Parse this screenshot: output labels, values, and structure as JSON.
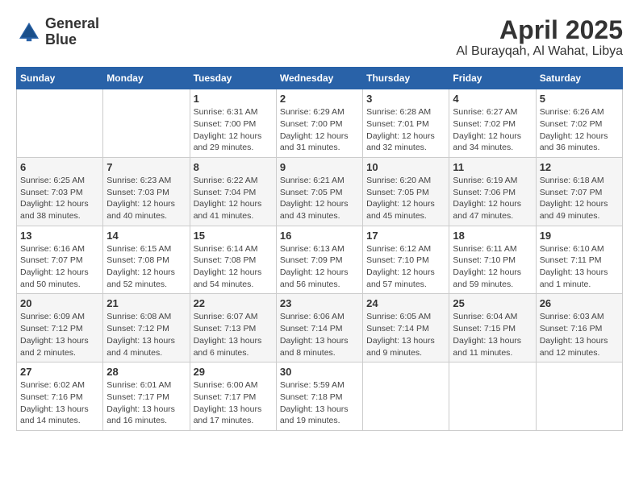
{
  "header": {
    "logo_line1": "General",
    "logo_line2": "Blue",
    "title": "April 2025",
    "subtitle": "Al Burayqah, Al Wahat, Libya"
  },
  "calendar": {
    "weekdays": [
      "Sunday",
      "Monday",
      "Tuesday",
      "Wednesday",
      "Thursday",
      "Friday",
      "Saturday"
    ],
    "weeks": [
      [
        {
          "day": "",
          "info": ""
        },
        {
          "day": "",
          "info": ""
        },
        {
          "day": "1",
          "info": "Sunrise: 6:31 AM\nSunset: 7:00 PM\nDaylight: 12 hours and 29 minutes."
        },
        {
          "day": "2",
          "info": "Sunrise: 6:29 AM\nSunset: 7:00 PM\nDaylight: 12 hours and 31 minutes."
        },
        {
          "day": "3",
          "info": "Sunrise: 6:28 AM\nSunset: 7:01 PM\nDaylight: 12 hours and 32 minutes."
        },
        {
          "day": "4",
          "info": "Sunrise: 6:27 AM\nSunset: 7:02 PM\nDaylight: 12 hours and 34 minutes."
        },
        {
          "day": "5",
          "info": "Sunrise: 6:26 AM\nSunset: 7:02 PM\nDaylight: 12 hours and 36 minutes."
        }
      ],
      [
        {
          "day": "6",
          "info": "Sunrise: 6:25 AM\nSunset: 7:03 PM\nDaylight: 12 hours and 38 minutes."
        },
        {
          "day": "7",
          "info": "Sunrise: 6:23 AM\nSunset: 7:03 PM\nDaylight: 12 hours and 40 minutes."
        },
        {
          "day": "8",
          "info": "Sunrise: 6:22 AM\nSunset: 7:04 PM\nDaylight: 12 hours and 41 minutes."
        },
        {
          "day": "9",
          "info": "Sunrise: 6:21 AM\nSunset: 7:05 PM\nDaylight: 12 hours and 43 minutes."
        },
        {
          "day": "10",
          "info": "Sunrise: 6:20 AM\nSunset: 7:05 PM\nDaylight: 12 hours and 45 minutes."
        },
        {
          "day": "11",
          "info": "Sunrise: 6:19 AM\nSunset: 7:06 PM\nDaylight: 12 hours and 47 minutes."
        },
        {
          "day": "12",
          "info": "Sunrise: 6:18 AM\nSunset: 7:07 PM\nDaylight: 12 hours and 49 minutes."
        }
      ],
      [
        {
          "day": "13",
          "info": "Sunrise: 6:16 AM\nSunset: 7:07 PM\nDaylight: 12 hours and 50 minutes."
        },
        {
          "day": "14",
          "info": "Sunrise: 6:15 AM\nSunset: 7:08 PM\nDaylight: 12 hours and 52 minutes."
        },
        {
          "day": "15",
          "info": "Sunrise: 6:14 AM\nSunset: 7:08 PM\nDaylight: 12 hours and 54 minutes."
        },
        {
          "day": "16",
          "info": "Sunrise: 6:13 AM\nSunset: 7:09 PM\nDaylight: 12 hours and 56 minutes."
        },
        {
          "day": "17",
          "info": "Sunrise: 6:12 AM\nSunset: 7:10 PM\nDaylight: 12 hours and 57 minutes."
        },
        {
          "day": "18",
          "info": "Sunrise: 6:11 AM\nSunset: 7:10 PM\nDaylight: 12 hours and 59 minutes."
        },
        {
          "day": "19",
          "info": "Sunrise: 6:10 AM\nSunset: 7:11 PM\nDaylight: 13 hours and 1 minute."
        }
      ],
      [
        {
          "day": "20",
          "info": "Sunrise: 6:09 AM\nSunset: 7:12 PM\nDaylight: 13 hours and 2 minutes."
        },
        {
          "day": "21",
          "info": "Sunrise: 6:08 AM\nSunset: 7:12 PM\nDaylight: 13 hours and 4 minutes."
        },
        {
          "day": "22",
          "info": "Sunrise: 6:07 AM\nSunset: 7:13 PM\nDaylight: 13 hours and 6 minutes."
        },
        {
          "day": "23",
          "info": "Sunrise: 6:06 AM\nSunset: 7:14 PM\nDaylight: 13 hours and 8 minutes."
        },
        {
          "day": "24",
          "info": "Sunrise: 6:05 AM\nSunset: 7:14 PM\nDaylight: 13 hours and 9 minutes."
        },
        {
          "day": "25",
          "info": "Sunrise: 6:04 AM\nSunset: 7:15 PM\nDaylight: 13 hours and 11 minutes."
        },
        {
          "day": "26",
          "info": "Sunrise: 6:03 AM\nSunset: 7:16 PM\nDaylight: 13 hours and 12 minutes."
        }
      ],
      [
        {
          "day": "27",
          "info": "Sunrise: 6:02 AM\nSunset: 7:16 PM\nDaylight: 13 hours and 14 minutes."
        },
        {
          "day": "28",
          "info": "Sunrise: 6:01 AM\nSunset: 7:17 PM\nDaylight: 13 hours and 16 minutes."
        },
        {
          "day": "29",
          "info": "Sunrise: 6:00 AM\nSunset: 7:17 PM\nDaylight: 13 hours and 17 minutes."
        },
        {
          "day": "30",
          "info": "Sunrise: 5:59 AM\nSunset: 7:18 PM\nDaylight: 13 hours and 19 minutes."
        },
        {
          "day": "",
          "info": ""
        },
        {
          "day": "",
          "info": ""
        },
        {
          "day": "",
          "info": ""
        }
      ]
    ]
  }
}
